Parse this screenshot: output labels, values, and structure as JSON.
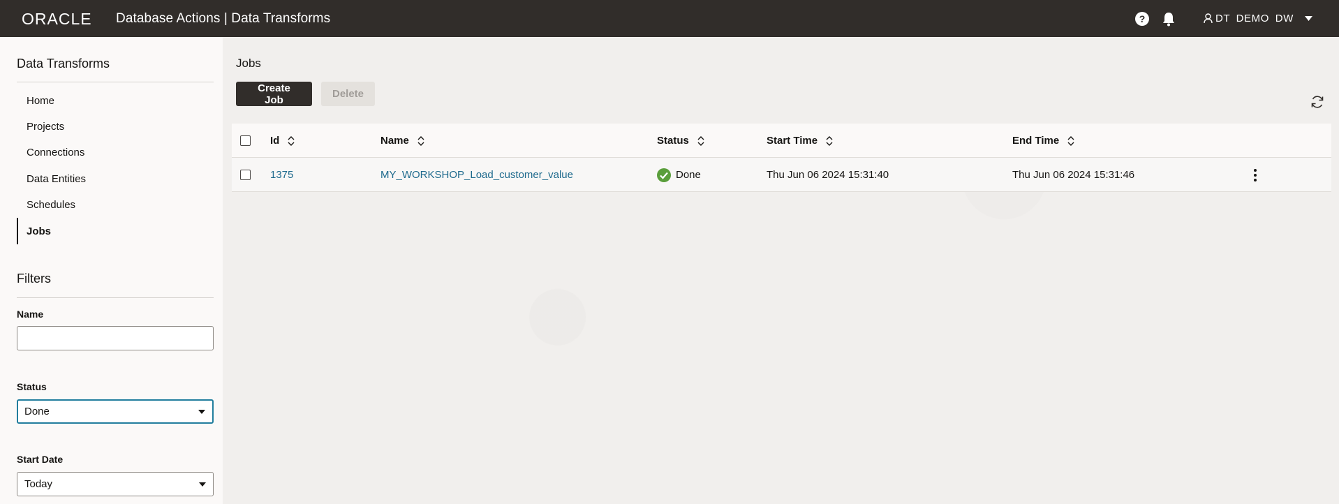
{
  "header": {
    "logo_text": "ORACLE",
    "title": "Database Actions | Data Transforms",
    "user": "DT DEMO DW"
  },
  "sidebar": {
    "title": "Data Transforms",
    "nav": [
      {
        "label": "Home"
      },
      {
        "label": "Projects"
      },
      {
        "label": "Connections"
      },
      {
        "label": "Data Entities"
      },
      {
        "label": "Schedules"
      },
      {
        "label": "Jobs",
        "active": true
      }
    ],
    "filters": {
      "title": "Filters",
      "name_label": "Name",
      "name_value": "",
      "status_label": "Status",
      "status_value": "Done",
      "start_date_label": "Start Date",
      "start_date_value": "Today"
    }
  },
  "main": {
    "title": "Jobs",
    "create_button": "Create Job",
    "delete_button": "Delete",
    "table": {
      "columns": [
        "Id",
        "Name",
        "Status",
        "Start Time",
        "End Time"
      ],
      "rows": [
        {
          "id": "1375",
          "name": "MY_WORKSHOP_Load_customer_value",
          "status": "Done",
          "start_time": "Thu Jun 06 2024 15:31:40",
          "end_time": "Thu Jun 06 2024 15:31:46"
        }
      ]
    }
  },
  "colors": {
    "header_bg": "#312d2a",
    "link": "#1e6a8d",
    "success": "#5a9e3b",
    "focus": "#227e9e"
  }
}
